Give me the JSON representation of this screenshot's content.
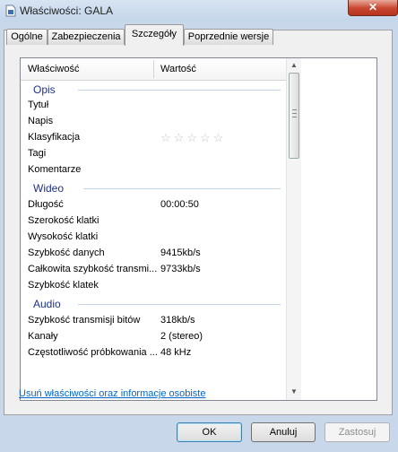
{
  "window": {
    "title": "Właściwości: GALA",
    "close_label": "✕"
  },
  "tabs": [
    {
      "label": "Ogólne"
    },
    {
      "label": "Zabezpieczenia"
    },
    {
      "label": "Szczegóły",
      "active": true
    },
    {
      "label": "Poprzednie wersje"
    }
  ],
  "columns": {
    "property": "Właściwość",
    "value": "Wartość"
  },
  "sections": {
    "opis": {
      "label": "Opis",
      "rows": {
        "tytul": {
          "name": "Tytuł",
          "value": ""
        },
        "napis": {
          "name": "Napis",
          "value": ""
        },
        "klasyfikacja": {
          "name": "Klasyfikacja",
          "rating": 0,
          "max": 5
        },
        "tagi": {
          "name": "Tagi",
          "value": ""
        },
        "komentarze": {
          "name": "Komentarze",
          "value": ""
        }
      }
    },
    "wideo": {
      "label": "Wideo",
      "rows": {
        "dlugosc": {
          "name": "Długość",
          "value": "00:00:50"
        },
        "szerokosc": {
          "name": "Szerokość klatki",
          "value": ""
        },
        "wysokosc": {
          "name": "Wysokość klatki",
          "value": ""
        },
        "szybkosc_danych": {
          "name": "Szybkość danych",
          "value": "9415kb/s"
        },
        "calkowita": {
          "name": "Całkowita szybkość transmi...",
          "value": "9733kb/s"
        },
        "szybkosc_klatek": {
          "name": "Szybkość klatek",
          "value": ""
        }
      }
    },
    "audio": {
      "label": "Audio",
      "rows": {
        "bity": {
          "name": "Szybkość transmisji bitów",
          "value": "318kb/s"
        },
        "kanaly": {
          "name": "Kanały",
          "value": "2 (stereo)"
        },
        "probkowanie": {
          "name": "Częstotliwość próbkowania ...",
          "value": "48 kHz"
        }
      }
    }
  },
  "footer_link": "Usuń właściwości oraz informacje osobiste",
  "buttons": {
    "ok": "OK",
    "cancel": "Anuluj",
    "apply": "Zastosuj"
  },
  "colors": {
    "group_text": "#1e3287",
    "link": "#0066cc",
    "window_frame": "#c8d8ea"
  }
}
